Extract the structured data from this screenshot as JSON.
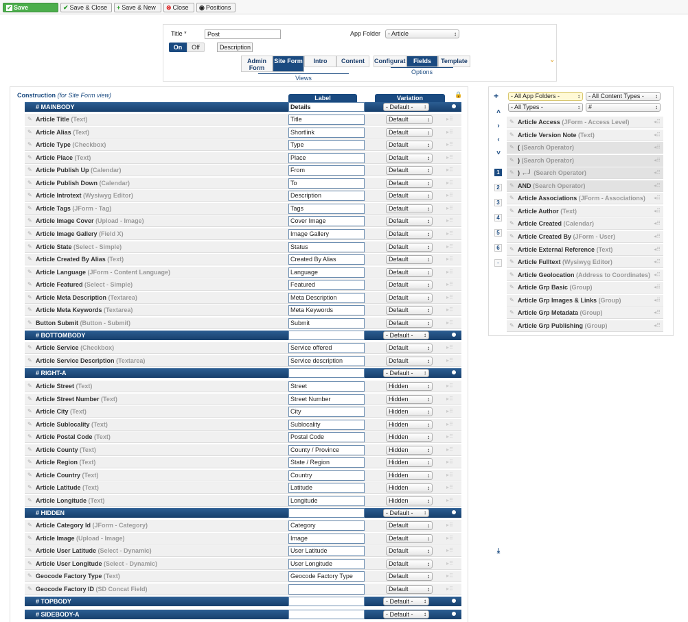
{
  "toolbar": {
    "save": "Save",
    "save_close": "Save & Close",
    "save_new": "Save & New",
    "close": "Close",
    "positions": "Positions"
  },
  "top": {
    "title_label": "Title *",
    "title_value": "Post",
    "app_folder_label": "App Folder",
    "app_folder_value": "- Article",
    "on": "On",
    "off": "Off",
    "description": "Description",
    "tabs": [
      "Admin Form",
      "Site Form",
      "Intro",
      "Content",
      "Configurati",
      "Fields",
      "Template"
    ],
    "views_label": "Views",
    "options_label": "Options"
  },
  "construction": {
    "title": "Construction",
    "subtitle": "(for Site Form view)",
    "col_label": "Label",
    "col_variation": "Variation"
  },
  "sections": [
    {
      "name": "# MAINBODY",
      "label": "Details",
      "variation": "- Default -"
    },
    {
      "name": "# BOTTOMBODY",
      "label": "",
      "variation": "- Default -"
    },
    {
      "name": "# RIGHT-A",
      "label": "",
      "variation": "- Default -"
    },
    {
      "name": "# HIDDEN",
      "label": "",
      "variation": "- Default -"
    },
    {
      "name": "# TOPBODY",
      "label": "",
      "variation": "- Default -"
    },
    {
      "name": "# SIDEBODY-A",
      "label": "",
      "variation": "- Default -"
    }
  ],
  "rows": [
    {
      "name": "Article Title",
      "type": "(Text)",
      "label": "Title",
      "variation": "Default"
    },
    {
      "name": "Article Alias",
      "type": "(Text)",
      "label": "Shortlink",
      "variation": "Default"
    },
    {
      "name": "Article Type",
      "type": "(Checkbox)",
      "label": "Type",
      "variation": "Default"
    },
    {
      "name": "Article Place",
      "type": "(Text)",
      "label": "Place",
      "variation": "Default"
    },
    {
      "name": "Article Publish Up",
      "type": "(Calendar)",
      "label": "From",
      "variation": "Default"
    },
    {
      "name": "Article Publish Down",
      "type": "(Calendar)",
      "label": "To",
      "variation": "Default"
    },
    {
      "name": "Article Introtext",
      "type": "(Wysiwyg Editor)",
      "label": "Description",
      "variation": "Default"
    },
    {
      "name": "Article Tags",
      "type": "(JForm - Tag)",
      "label": "Tags",
      "variation": "Default"
    },
    {
      "name": "Article Image Cover",
      "type": "(Upload - Image)",
      "label": "Cover Image",
      "variation": "Default"
    },
    {
      "name": "Article Image Gallery",
      "type": "(Field X)",
      "label": "Image Gallery",
      "variation": "Default"
    },
    {
      "name": "Article State",
      "type": "(Select - Simple)",
      "label": "Status",
      "variation": "Default"
    },
    {
      "name": "Article Created By Alias",
      "type": "(Text)",
      "label": "Created By Alias",
      "variation": "Default"
    },
    {
      "name": "Article Language",
      "type": "(JForm - Content Language)",
      "label": "Language",
      "variation": "Default"
    },
    {
      "name": "Article Featured",
      "type": "(Select - Simple)",
      "label": "Featured",
      "variation": "Default"
    },
    {
      "name": "Article Meta Description",
      "type": "(Textarea)",
      "label": "Meta Description",
      "variation": "Default"
    },
    {
      "name": "Article Meta Keywords",
      "type": "(Textarea)",
      "label": "Meta Keywords",
      "variation": "Default"
    },
    {
      "name": "Button Submit",
      "type": "(Button - Submit)",
      "label": "Submit",
      "variation": "Default"
    },
    {
      "name": "Article Service",
      "type": "(Checkbox)",
      "label": "Service offered",
      "variation": "Default"
    },
    {
      "name": "Article Service Description",
      "type": "(Textarea)",
      "label": "Service description",
      "variation": "Default"
    },
    {
      "name": "Article Street",
      "type": "(Text)",
      "label": "Street",
      "variation": "Hidden"
    },
    {
      "name": "Article Street Number",
      "type": "(Text)",
      "label": "Street Number",
      "variation": "Hidden"
    },
    {
      "name": "Article City",
      "type": "(Text)",
      "label": "City",
      "variation": "Hidden"
    },
    {
      "name": "Article Sublocality",
      "type": "(Text)",
      "label": "Sublocality",
      "variation": "Hidden"
    },
    {
      "name": "Article Postal Code",
      "type": "(Text)",
      "label": "Postal Code",
      "variation": "Hidden"
    },
    {
      "name": "Article County",
      "type": "(Text)",
      "label": "County / Province",
      "variation": "Hidden"
    },
    {
      "name": "Article Region",
      "type": "(Text)",
      "label": "State / Region",
      "variation": "Hidden"
    },
    {
      "name": "Article Country",
      "type": "(Text)",
      "label": "Country",
      "variation": "Hidden"
    },
    {
      "name": "Article Latitude",
      "type": "(Text)",
      "label": "Latitude",
      "variation": "Hidden"
    },
    {
      "name": "Article Longitude",
      "type": "(Text)",
      "label": "Longitude",
      "variation": "Hidden"
    },
    {
      "name": "Article Category Id",
      "type": "(JForm - Category)",
      "label": "Category",
      "variation": "Default"
    },
    {
      "name": "Article Image",
      "type": "(Upload - Image)",
      "label": "Image",
      "variation": "Default"
    },
    {
      "name": "Article User Latitude",
      "type": "(Select - Dynamic)",
      "label": "User Latitude",
      "variation": "Default"
    },
    {
      "name": "Article User Longitude",
      "type": "(Select - Dynamic)",
      "label": "User Longitude",
      "variation": "Default"
    },
    {
      "name": "Geocode Factory Type",
      "type": "(Text)",
      "label": "Geocode Factory Type",
      "variation": "Default"
    },
    {
      "name": "Geocode Factory ID",
      "type": "(SD Concat Field)",
      "label": "",
      "variation": "Default"
    }
  ],
  "filters": {
    "app_folders": "- All App Folders -",
    "content_types": "- All Content Types -",
    "types": "- All Types -",
    "hash": "#"
  },
  "side_numbers": [
    "1",
    "2",
    "3",
    "4",
    "5",
    "6",
    "·"
  ],
  "available": [
    {
      "name": "Article Access",
      "type": "(JForm - Access Level)",
      "grey": false
    },
    {
      "name": "Article Version Note",
      "type": "(Text)",
      "grey": false
    },
    {
      "name": "(",
      "type": "(Search Operator)",
      "grey": true
    },
    {
      "name": ")",
      "type": "(Search Operator)",
      "grey": true
    },
    {
      "name": ") ←┘",
      "type": "(Search Operator)",
      "grey": true
    },
    {
      "name": "AND",
      "type": "(Search Operator)",
      "grey": true
    },
    {
      "name": "Article Associations",
      "type": "(JForm - Associations)",
      "grey": false
    },
    {
      "name": "Article Author",
      "type": "(Text)",
      "grey": false
    },
    {
      "name": "Article Created",
      "type": "(Calendar)",
      "grey": false
    },
    {
      "name": "Article Created By",
      "type": "(JForm - User)",
      "grey": false
    },
    {
      "name": "Article External Reference",
      "type": "(Text)",
      "grey": false
    },
    {
      "name": "Article Fulltext",
      "type": "(Wysiwyg Editor)",
      "grey": false
    },
    {
      "name": "Article Geolocation",
      "type": "(Address to Coordinates)",
      "grey": false
    },
    {
      "name": "Article Grp Basic",
      "type": "(Group)",
      "grey": false
    },
    {
      "name": "Article Grp Images & Links",
      "type": "(Group)",
      "grey": false
    },
    {
      "name": "Article Grp Metadata",
      "type": "(Group)",
      "grey": false
    },
    {
      "name": "Article Grp Publishing",
      "type": "(Group)",
      "grey": false
    }
  ]
}
